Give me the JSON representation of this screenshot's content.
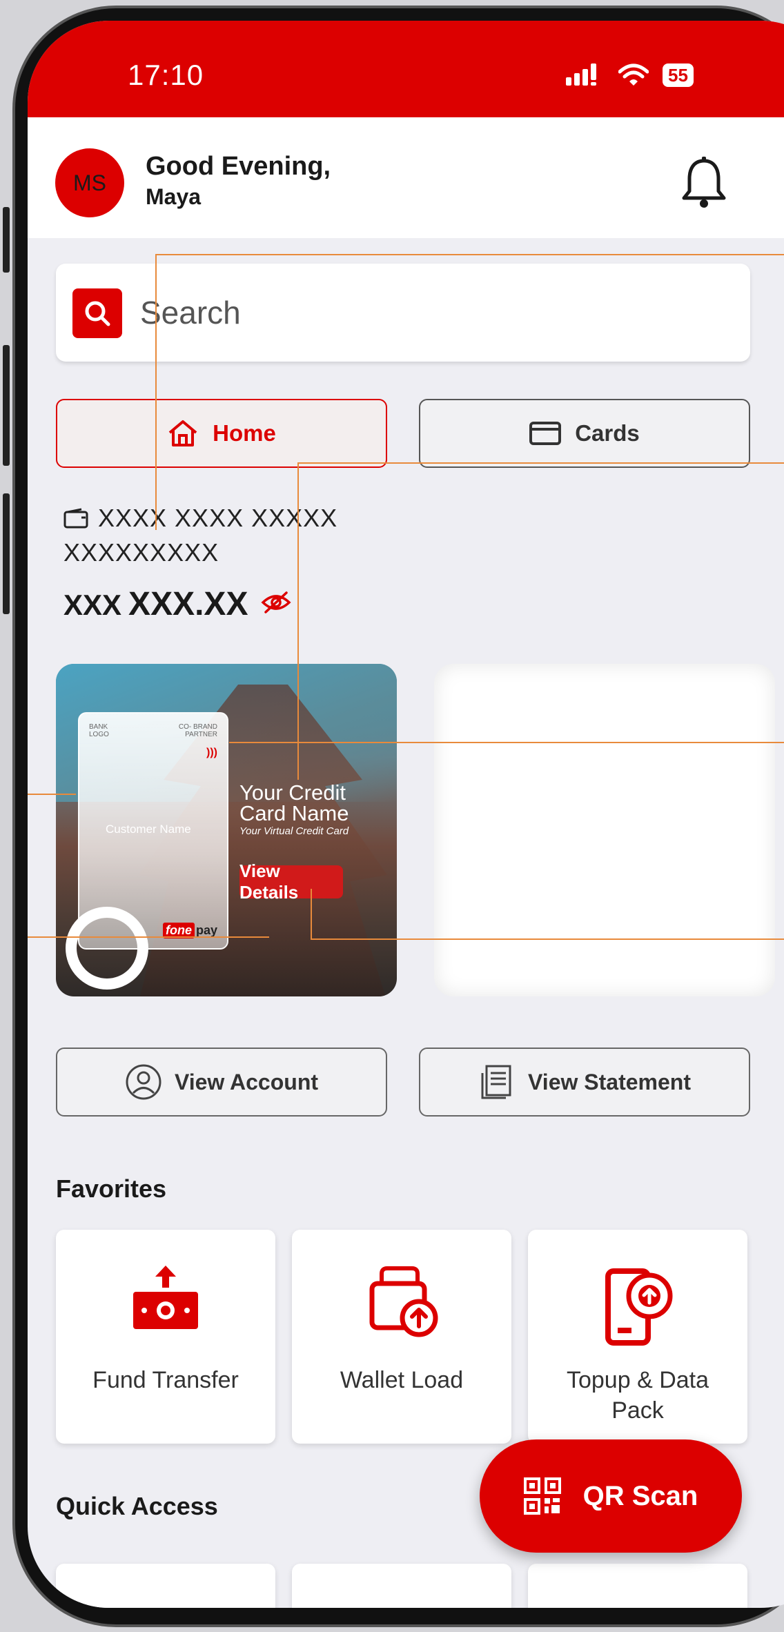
{
  "status_bar": {
    "time": "17:10",
    "battery": "55"
  },
  "header": {
    "avatar_initials": "MS",
    "greeting": "Good Evening,",
    "username": "Maya"
  },
  "search": {
    "placeholder": "Search"
  },
  "tabs": [
    {
      "label": "Home",
      "active": true
    },
    {
      "label": "Cards",
      "active": false
    }
  ],
  "account": {
    "number_line1": "XXXX XXXX XXXXX",
    "number_line2": "XXXXXXXXX",
    "currency": "XXX",
    "balance": "XXX.XX"
  },
  "credit_card": {
    "bank_logo": "BANK LOGO",
    "co_brand": "CO- BRAND PARTNER",
    "customer_name": "Customer Name",
    "title": "Your Credit Card Name",
    "subtitle": "Your Virtual Credit Card",
    "button": "View Details",
    "brand_fone": "fone",
    "brand_pay": "pay"
  },
  "actions": [
    {
      "label": "View Account",
      "icon": "user-circle-icon"
    },
    {
      "label": "View Statement",
      "icon": "statement-icon"
    }
  ],
  "favorites": {
    "title": "Favorites",
    "items": [
      {
        "label": "Fund Transfer",
        "icon": "fund-transfer-icon"
      },
      {
        "label": "Wallet Load",
        "icon": "wallet-load-icon"
      },
      {
        "label": "Topup & Data Pack",
        "icon": "topup-icon"
      }
    ]
  },
  "quick_access": {
    "title": "Quick Access"
  },
  "qr_button": {
    "label": "QR Scan"
  },
  "colors": {
    "brand": "#dc0000",
    "background": "#eeeef3",
    "annotation": "#e88a3b"
  }
}
